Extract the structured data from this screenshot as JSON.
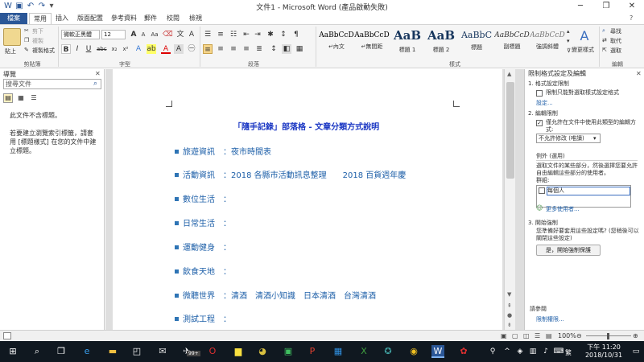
{
  "titlebar": {
    "title": "文件1 - Microsoft Word (產品啟動失敗)"
  },
  "tabs": [
    "檔案",
    "常用",
    "插入",
    "版面配置",
    "參考資料",
    "郵件",
    "校閱",
    "檢視"
  ],
  "ribbon": {
    "clipboard": {
      "paste": "貼上",
      "cut": "剪下",
      "copy": "複製",
      "format_painter": "複製格式",
      "label": "剪貼簿"
    },
    "font": {
      "name": "微軟正黑體",
      "size": "12",
      "label": "字型"
    },
    "paragraph": {
      "label": "段落"
    },
    "styles": {
      "items": [
        {
          "sample": "AaBbCcD",
          "name": "↵內文"
        },
        {
          "sample": "AaBbCcD",
          "name": "↵無間距"
        },
        {
          "sample": "AaB",
          "name": "標題 1"
        },
        {
          "sample": "AaB",
          "name": "標題 2"
        },
        {
          "sample": "AaBbC",
          "name": "標題"
        },
        {
          "sample": "AaBbCcD",
          "name": "副標題"
        },
        {
          "sample": "AaBbCcD",
          "name": "強調斜體"
        }
      ],
      "change_styles": "變更樣式",
      "label": "樣式"
    },
    "editing": {
      "find": "尋找",
      "replace": "取代",
      "select": "選取",
      "label": "編輯"
    }
  },
  "navpane": {
    "header": "導覽",
    "search_placeholder": "搜尋文件",
    "no_headings": "此文件不含標題。",
    "hint": "若要建立瀏覽索引標籤，請套用 [標題樣式] 在您的文件中建立標題。"
  },
  "document": {
    "title": "「隨手記錄」部落格 - 文章分類方式說明",
    "lines": [
      "旅遊資訊　：夜市時間表",
      "活動資訊　：2018 各縣市活動訊息整理　　2018 百貨週年慶",
      "數位生活　：",
      "日常生活　：",
      "運動健身　：",
      "飲食天地　：",
      "微聽世界　：清酒　清酒小知識　日本清酒　台灣清酒",
      "測試工程　："
    ]
  },
  "restrict_pane": {
    "header": "限制格式設定及編輯",
    "section1_title": "1. 格式設定限制",
    "section1_option": "限制只能對選取樣式設定格式",
    "section1_link": "設定...",
    "section2_title": "2. 編輯限制",
    "section2_option": "僅允許在文件中使用此類型的編輯方式:",
    "section2_select": "不允許修改 (唯讀)",
    "exceptions_title": "例外 (選用)",
    "exceptions_desc": "選取文件的某些部分，然後選擇您要允許自由編輯這些部分的使用者。",
    "group_label": "群組:",
    "everyone": "每個人",
    "more_users": "更多使用者...",
    "section3_title": "3. 開始強制",
    "section3_desc": "您準備好要套用這些設定嗎? (您稍後可以關閉這些設定)",
    "enforce_button": "是，開始強制保護",
    "see_also": "請參閱",
    "permissions_link": "限制權限..."
  },
  "statusbar": {
    "zoom": "100%"
  },
  "taskbar": {
    "time": "下午 11:20",
    "date": "2018/10/31",
    "ime": "繁",
    "badge": "99+"
  }
}
